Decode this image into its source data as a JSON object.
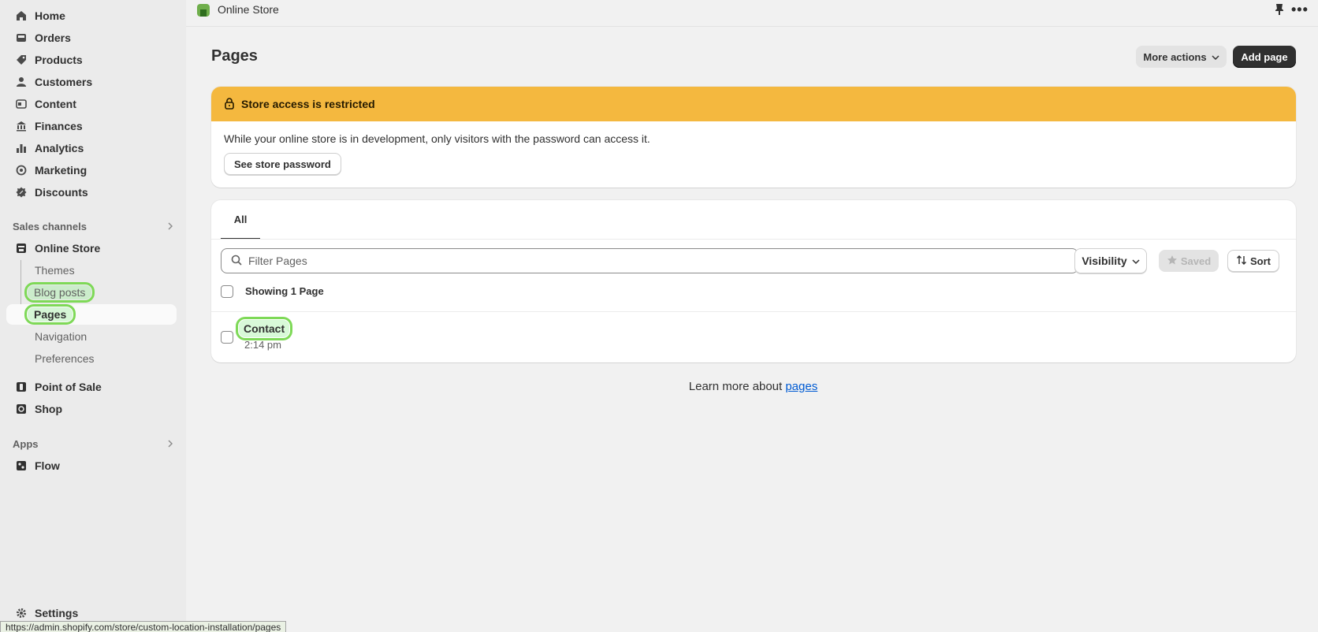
{
  "topbar": {
    "store_label": "Online Store"
  },
  "sidebar": {
    "main": [
      {
        "label": "Home",
        "icon": "home-icon"
      },
      {
        "label": "Orders",
        "icon": "orders-icon"
      },
      {
        "label": "Products",
        "icon": "tag-icon"
      },
      {
        "label": "Customers",
        "icon": "person-icon"
      },
      {
        "label": "Content",
        "icon": "content-icon"
      },
      {
        "label": "Finances",
        "icon": "bank-icon"
      },
      {
        "label": "Analytics",
        "icon": "bar-chart-icon"
      },
      {
        "label": "Marketing",
        "icon": "target-icon"
      },
      {
        "label": "Discounts",
        "icon": "discount-icon"
      }
    ],
    "sales_channels_label": "Sales channels",
    "online_store": "Online Store",
    "online_store_sub": [
      "Themes",
      "Blog posts",
      "Pages",
      "Navigation",
      "Preferences"
    ],
    "point_of_sale": "Point of Sale",
    "shop": "Shop",
    "apps_label": "Apps",
    "flow": "Flow",
    "settings": "Settings"
  },
  "header": {
    "title": "Pages",
    "more_actions": "More actions",
    "add_page": "Add page"
  },
  "banner": {
    "title": "Store access is restricted",
    "text": "While your online store is in development, only visitors with the password can access it.",
    "button": "See store password"
  },
  "list": {
    "tab_all": "All",
    "search_placeholder": "Filter Pages",
    "visibility": "Visibility",
    "saved": "Saved",
    "sort": "Sort",
    "showing": "Showing 1 Page",
    "rows": [
      {
        "title": "Contact",
        "time": "2:14 pm"
      }
    ]
  },
  "learn_more": {
    "prefix": "Learn more about ",
    "link": "pages"
  },
  "status_url": "https://admin.shopify.com/store/custom-location-installation/pages",
  "colors": {
    "banner": "#f4b83f",
    "primary_button": "#303030",
    "link": "#005bd3",
    "highlight": "#7ed957"
  }
}
